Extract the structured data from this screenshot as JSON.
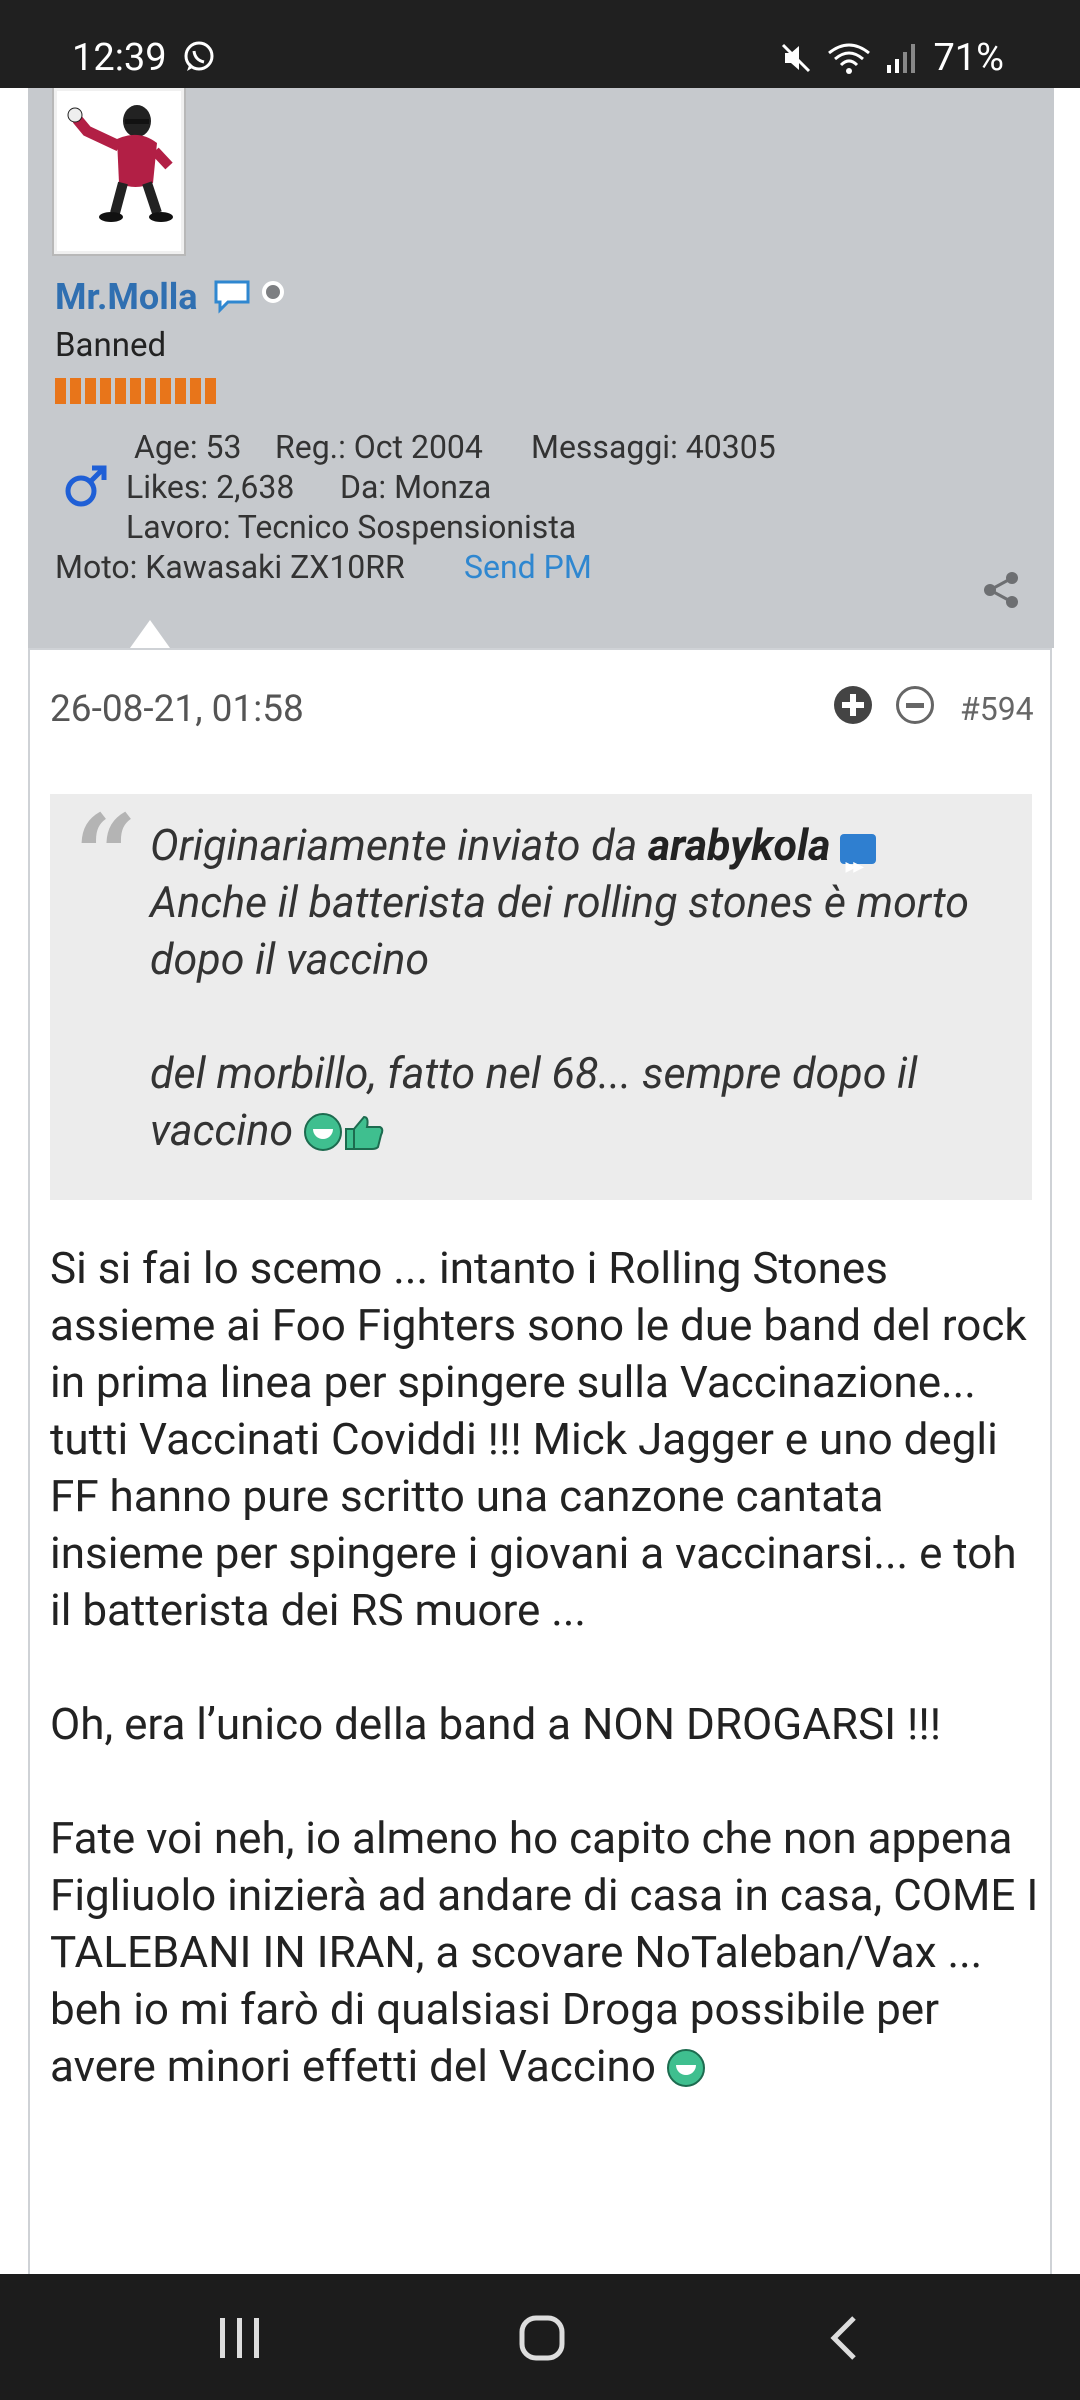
{
  "status_bar": {
    "time": "12:39",
    "battery": "71%",
    "icons": [
      "whatsapp-icon",
      "mute-icon",
      "wifi-icon",
      "signal-icon"
    ]
  },
  "user": {
    "name": "Mr.Molla",
    "title": "Banned",
    "age": "Age: 53",
    "registered": "Reg.: Oct 2004",
    "messages": "Messaggi: 40305",
    "likes": "Likes: 2,638",
    "location": "Da: Monza",
    "job": "Lavoro: Tecnico Sospensionista",
    "bike": "Moto: Kawasaki ZX10RR",
    "send_pm": "Send PM",
    "reputation_bars": 11
  },
  "post": {
    "date": "26-08-21, 01:58",
    "number": "#594",
    "quote": {
      "intro": "Originariamente inviato da",
      "author": "arabykola",
      "line1": "Anche il batterista dei rolling stones è morto dopo il vaccino",
      "line2": "del morbillo, fatto nel 68... sempre dopo il vaccino"
    },
    "paragraphs": [
      "Si si fai lo scemo ... intanto i Rolling Stones assieme ai Foo Fighters sono le due band del rock in prima linea per spingere sulla Vaccinazione... tutti Vaccinati Coviddi !!! Mick Jagger e uno degli FF hanno pure scritto una canzone cantata insieme per spingere i giovani a vaccinarsi... e toh il batterista dei RS muore ...",
      "Oh, era l’unico della band a NON DROGARSI !!!",
      "Fate voi neh, io almeno ho capito che non appena Figliuolo inizierà ad andare di casa in casa, COME I TALEBANI IN IRAN, a scovare NoTaleban/Vax ... beh io mi farò di qualsiasi Droga possibile per avere minori effetti del Vaccino"
    ]
  },
  "colors": {
    "panel_bg": "#c6c9cd",
    "username": "#2f6fb1",
    "link": "#2f87d0",
    "reputation": "#e8751a"
  }
}
